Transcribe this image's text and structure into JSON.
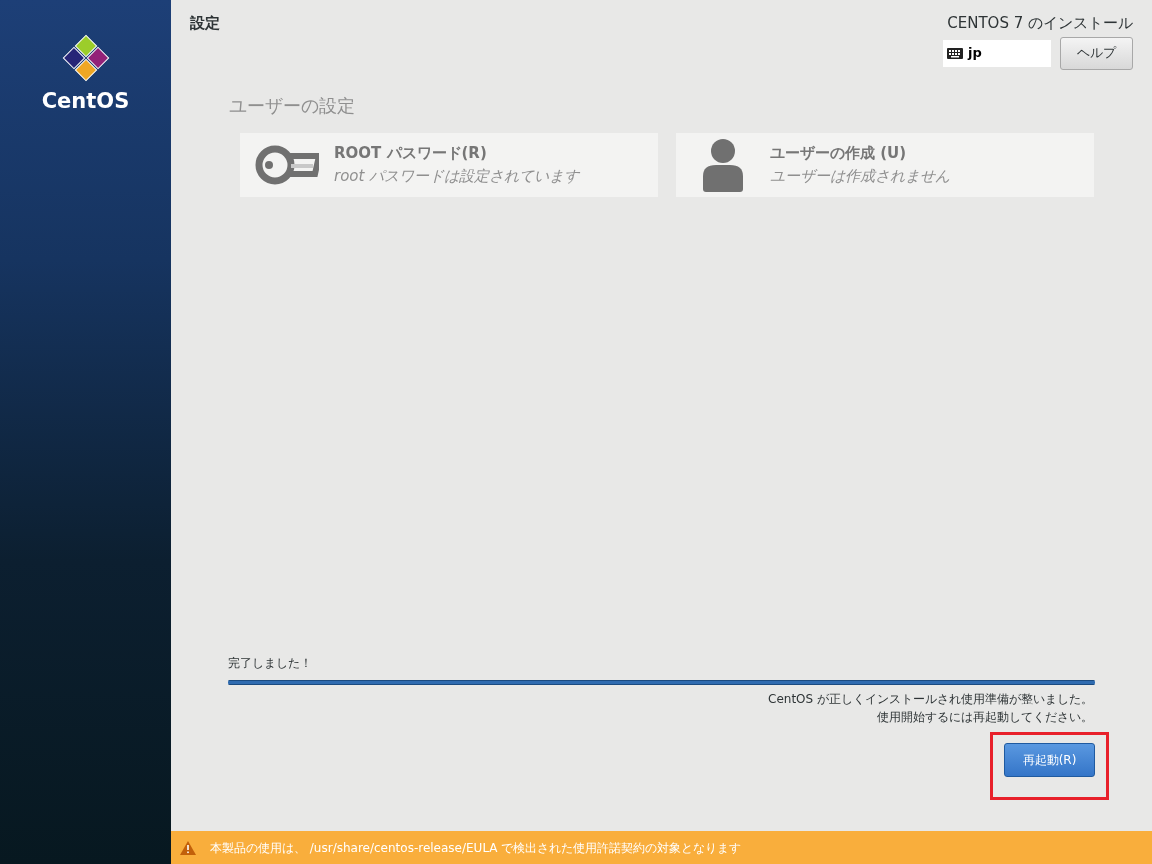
{
  "sidebar": {
    "logo_text": "CentOS"
  },
  "header": {
    "title": "設定",
    "product": "CENTOS 7 のインストール",
    "keyboard": "jp",
    "help_button": "ヘルプ"
  },
  "section": {
    "title": "ユーザーの設定",
    "spokes": [
      {
        "kind": "key",
        "title": "ROOT パスワード(R)",
        "status": "root パスワードは設定されています"
      },
      {
        "kind": "user",
        "title": "ユーザーの作成 (U)",
        "status": "ユーザーは作成されません"
      }
    ]
  },
  "progress": {
    "label": "完了しました！",
    "level": 1,
    "messages": [
      "CentOS が正しくインストールされ使用準備が整いました。",
      "使用開始するには再起動してください。"
    ],
    "reboot_button": "再起動(R)",
    "highlighted": true
  },
  "footer": {
    "warning": "本製品の使用は、 /usr/share/centos-release/EULA で検出された使用許諾契約の対象となります"
  }
}
